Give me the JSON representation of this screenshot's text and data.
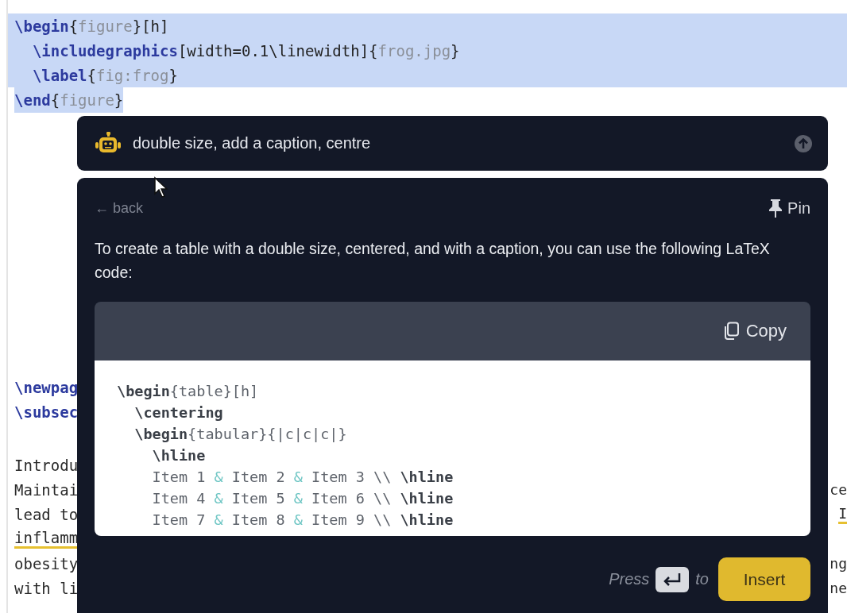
{
  "editor": {
    "blocks": [
      {
        "lines": [
          {
            "selected": true,
            "selection_to_line_end": true,
            "segments": [
              {
                "kind": "cmd",
                "text": "\\begin"
              },
              {
                "kind": "brace",
                "text": "{"
              },
              {
                "kind": "arg",
                "text": "figure"
              },
              {
                "kind": "brace",
                "text": "}[h]"
              }
            ]
          },
          {
            "selected": true,
            "selection_to_line_end": true,
            "segments": [
              {
                "kind": "cmd",
                "text": "  \\includegraphics"
              },
              {
                "kind": "brace",
                "text": "[width=0.1\\linewidth]{"
              },
              {
                "kind": "arg",
                "text": "frog.jpg"
              },
              {
                "kind": "brace",
                "text": "}"
              }
            ]
          },
          {
            "selected": true,
            "selection_to_line_end": true,
            "segments": [
              {
                "kind": "cmd",
                "text": "  \\label"
              },
              {
                "kind": "brace",
                "text": "{"
              },
              {
                "kind": "arg",
                "text": "fig:frog"
              },
              {
                "kind": "brace",
                "text": "}"
              }
            ]
          },
          {
            "selected": true,
            "selection_to_line_end": false,
            "segments": [
              {
                "kind": "cmd",
                "text": "\\end"
              },
              {
                "kind": "brace",
                "text": "{"
              },
              {
                "kind": "arg",
                "text": "figure"
              },
              {
                "kind": "brace",
                "text": "}"
              }
            ]
          }
        ]
      },
      {
        "lines": [
          {
            "selected": false,
            "segments": [
              {
                "kind": "cmd",
                "text": "\\newpag"
              }
            ]
          },
          {
            "selected": false,
            "segments": [
              {
                "kind": "cmd",
                "text": "\\subsec"
              }
            ]
          }
        ]
      },
      {
        "lines": [
          {
            "selected": false,
            "segments": [
              {
                "kind": "text",
                "text": "Introdu"
              }
            ]
          },
          {
            "selected": false,
            "segments": [
              {
                "kind": "text",
                "text": "Maintai"
              }
            ],
            "right": {
              "text": "ce"
            }
          },
          {
            "selected": false,
            "segments": [
              {
                "kind": "text",
                "text": "lead to"
              }
            ],
            "right": {
              "text": "I",
              "flagged": true
            }
          },
          {
            "selected": false,
            "segments": [
              {
                "kind": "text",
                "text": "inflamm"
              }
            ],
            "flagged": true
          },
          {
            "selected": false,
            "segments": [
              {
                "kind": "text",
                "text": "obesity"
              }
            ],
            "right": {
              "text": "ng"
            }
          },
          {
            "selected": false,
            "segments": [
              {
                "kind": "text",
                "text": "with li"
              }
            ],
            "right": {
              "text": "ne"
            }
          }
        ]
      }
    ]
  },
  "prompt": {
    "value": "double size, add a caption, centre"
  },
  "panel": {
    "back": "← back",
    "pin": "Pin",
    "message": "To create a table with a double size, centered, and with a caption, you can use the following LaTeX code:",
    "code": {
      "copy": "Copy",
      "lines": [
        [
          {
            "kind": "cmd",
            "text": "\\begin"
          },
          {
            "kind": "arg",
            "text": "{table}[h]"
          }
        ],
        [
          {
            "kind": "cmd",
            "text": "  \\centering"
          }
        ],
        [
          {
            "kind": "cmd",
            "text": "  \\begin"
          },
          {
            "kind": "arg",
            "text": "{tabular}{|c|c|c|}"
          }
        ],
        [
          {
            "kind": "cmd",
            "text": "    \\hline"
          }
        ],
        [
          {
            "kind": "arg",
            "text": "    Item 1 "
          },
          {
            "kind": "amp",
            "text": "&"
          },
          {
            "kind": "arg",
            "text": " Item 2 "
          },
          {
            "kind": "amp",
            "text": "&"
          },
          {
            "kind": "arg",
            "text": " Item 3 \\\\ "
          },
          {
            "kind": "cmd",
            "text": "\\hline"
          }
        ],
        [
          {
            "kind": "arg",
            "text": "    Item 4 "
          },
          {
            "kind": "amp",
            "text": "&"
          },
          {
            "kind": "arg",
            "text": " Item 5 "
          },
          {
            "kind": "amp",
            "text": "&"
          },
          {
            "kind": "arg",
            "text": " Item 6 \\\\ "
          },
          {
            "kind": "cmd",
            "text": "\\hline"
          }
        ],
        [
          {
            "kind": "arg",
            "text": "    Item 7 "
          },
          {
            "kind": "amp",
            "text": "&"
          },
          {
            "kind": "arg",
            "text": " Item 8 "
          },
          {
            "kind": "amp",
            "text": "&"
          },
          {
            "kind": "arg",
            "text": " Item 9 \\\\ "
          },
          {
            "kind": "cmd",
            "text": "\\hline"
          }
        ]
      ]
    },
    "footer": {
      "press": "Press",
      "to": "to",
      "insert": "Insert"
    }
  }
}
